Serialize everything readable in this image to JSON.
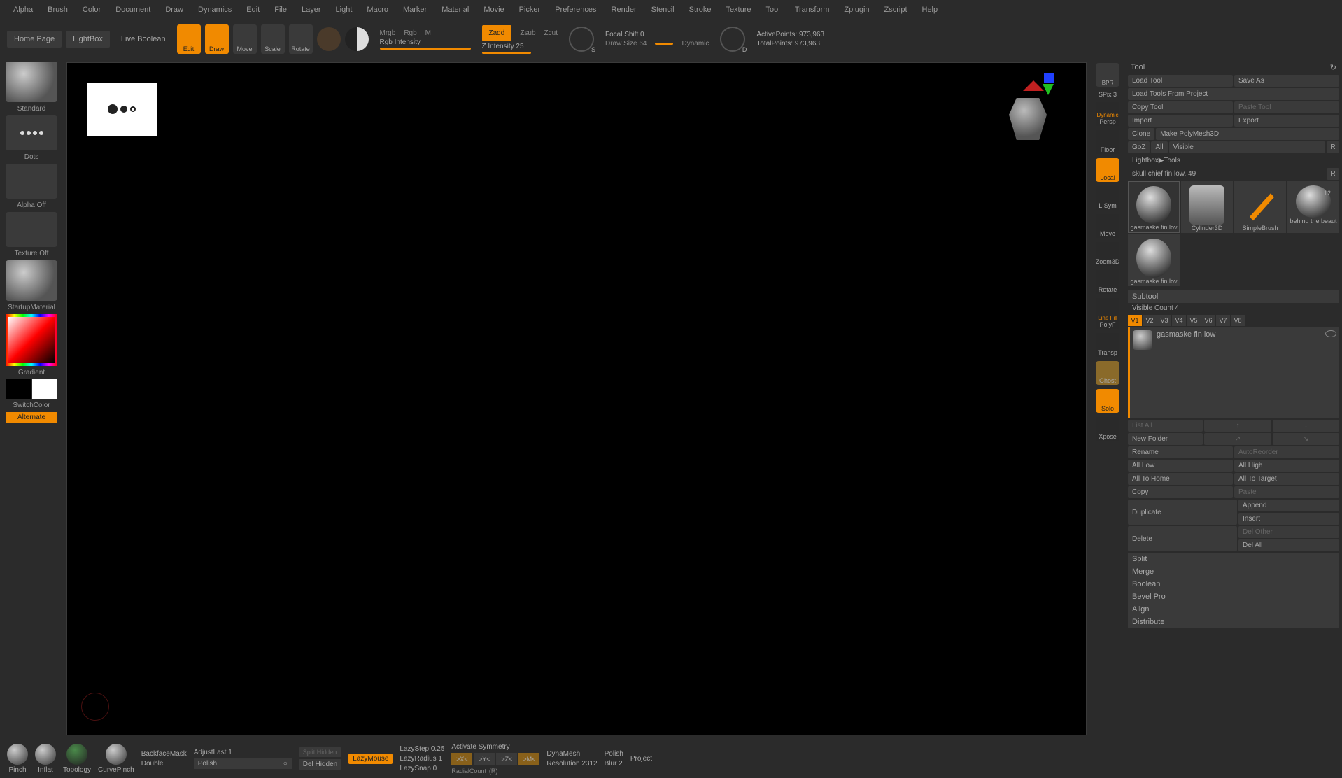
{
  "menu": [
    "Alpha",
    "Brush",
    "Color",
    "Document",
    "Draw",
    "Dynamics",
    "Edit",
    "File",
    "Layer",
    "Light",
    "Macro",
    "Marker",
    "Material",
    "Movie",
    "Picker",
    "Preferences",
    "Render",
    "Stencil",
    "Stroke",
    "Texture",
    "Tool",
    "Transform",
    "Zplugin",
    "Zscript",
    "Help"
  ],
  "toolbar": {
    "home": "Home Page",
    "lightbox": "LightBox",
    "liveboolean": "Live Boolean",
    "edit": "Edit",
    "draw": "Draw",
    "move": "Move",
    "scale": "Scale",
    "rotate": "Rotate",
    "mrgb": "Mrgb",
    "rgb": "Rgb",
    "m": "M",
    "rgb_int": "Rgb Intensity",
    "zadd": "Zadd",
    "zsub": "Zsub",
    "zcut": "Zcut",
    "zint": "Z Intensity 25",
    "focal": "Focal Shift 0",
    "drawsize": "Draw Size 64",
    "dynamic": "Dynamic",
    "active": "ActivePoints: 973,963",
    "total": "TotalPoints: 973,963"
  },
  "left": {
    "standard": "Standard",
    "dots": "Dots",
    "alphaoff": "Alpha Off",
    "textureoff": "Texture Off",
    "startupmat": "StartupMaterial",
    "gradient": "Gradient",
    "switchcolor": "SwitchColor",
    "alternate": "Alternate"
  },
  "rside": {
    "bpr": "BPR",
    "spix": "SPix 3",
    "dynamic": "Dynamic",
    "persp": "Persp",
    "floor": "Floor",
    "local": "Local",
    "lsym": "L.Sym",
    "move": "Move",
    "zoom3d": "Zoom3D",
    "rotate": "Rotate",
    "linefill": "Line Fill",
    "polyf": "PolyF",
    "transp": "Transp",
    "ghost": "Ghost",
    "solo": "Solo",
    "xpose": "Xpose"
  },
  "right": {
    "title": "Tool",
    "load": "Load Tool",
    "saveas": "Save As",
    "loadproj": "Load Tools From Project",
    "copy": "Copy Tool",
    "paste": "Paste Tool",
    "import": "Import",
    "export": "Export",
    "clone": "Clone",
    "polymesh": "Make PolyMesh3D",
    "goz": "GoZ",
    "all": "All",
    "visible": "Visible",
    "r": "R",
    "lightboxtools": "Lightbox▶Tools",
    "skull": "skull chief fin low. 49",
    "t1": "gasmaske fin lov",
    "t2": "Cylinder3D",
    "t3": "SimpleBrush",
    "t4": "behind the beaut",
    "t5": "gasmaske fin lov",
    "t4n": "12",
    "subtool": "Subtool",
    "viscount": "Visible Count 4",
    "v": [
      "V1",
      "V2",
      "V3",
      "V4",
      "V5",
      "V6",
      "V7",
      "V8"
    ],
    "stname": "gasmaske fin low",
    "listall": "List All",
    "newfolder": "New Folder",
    "rename": "Rename",
    "autoreorder": "AutoReorder",
    "alllow": "All Low",
    "allhigh": "All High",
    "alltohome": "All To Home",
    "alltotarget": "All To Target",
    "copy2": "Copy",
    "paste2": "Paste",
    "dup": "Duplicate",
    "append": "Append",
    "insert": "Insert",
    "delete": "Delete",
    "delother": "Del Other",
    "delall": "Del All",
    "split": "Split",
    "merge": "Merge",
    "boolean": "Boolean",
    "bevelpro": "Bevel Pro",
    "align": "Align",
    "distribute": "Distribute"
  },
  "bottom": {
    "pinch": "Pinch",
    "inflat": "Inflat",
    "topology": "Topology",
    "curvepinch": "CurvePinch",
    "backface": "BackfaceMask",
    "double": "Double",
    "adjust": "AdjustLast 1",
    "polish": "Polish",
    "splithidden": "Split Hidden",
    "delhidden": "Del Hidden",
    "lazymouse": "LazyMouse",
    "lazystep": "LazyStep 0.25",
    "lazyradius": "LazyRadius 1",
    "lazysnap": "LazySnap 0",
    "activatesym": "Activate Symmetry",
    "xsym": ">X<",
    "ysym": ">Y<",
    "zsym": ">Z<",
    "msym": ">M<",
    "radialcount": "RadialCount",
    "r2": "(R)",
    "dynamesh": "DynaMesh",
    "resolution": "Resolution 2312",
    "polish2": "Polish",
    "blur": "Blur 2",
    "project": "Project"
  }
}
